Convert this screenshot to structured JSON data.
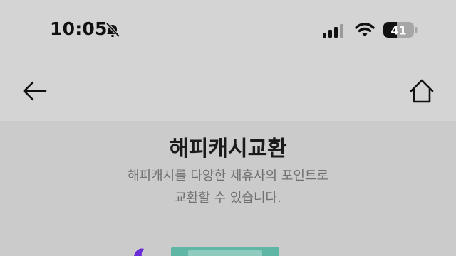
{
  "status_bar": {
    "time": "10:05",
    "battery_level": "41",
    "icons": [
      "bell-off-icon",
      "cellular-signal-icon",
      "wifi-icon",
      "battery-icon"
    ]
  },
  "nav": {
    "back_icon": "arrow-left-icon",
    "home_icon": "home-icon"
  },
  "page": {
    "title": "해피캐시교환",
    "description_line1": "해피캐시를 다양한 제휴사의 포인트로",
    "description_line2": "교환할 수 있습니다."
  },
  "colors": {
    "background": "#d3d3d3",
    "content_background": "#cbcbcb",
    "title_text": "#1a1a1a",
    "description_text": "#707070",
    "illustration_green": "#5fb6a5",
    "illustration_purple": "#6a2bd8"
  }
}
